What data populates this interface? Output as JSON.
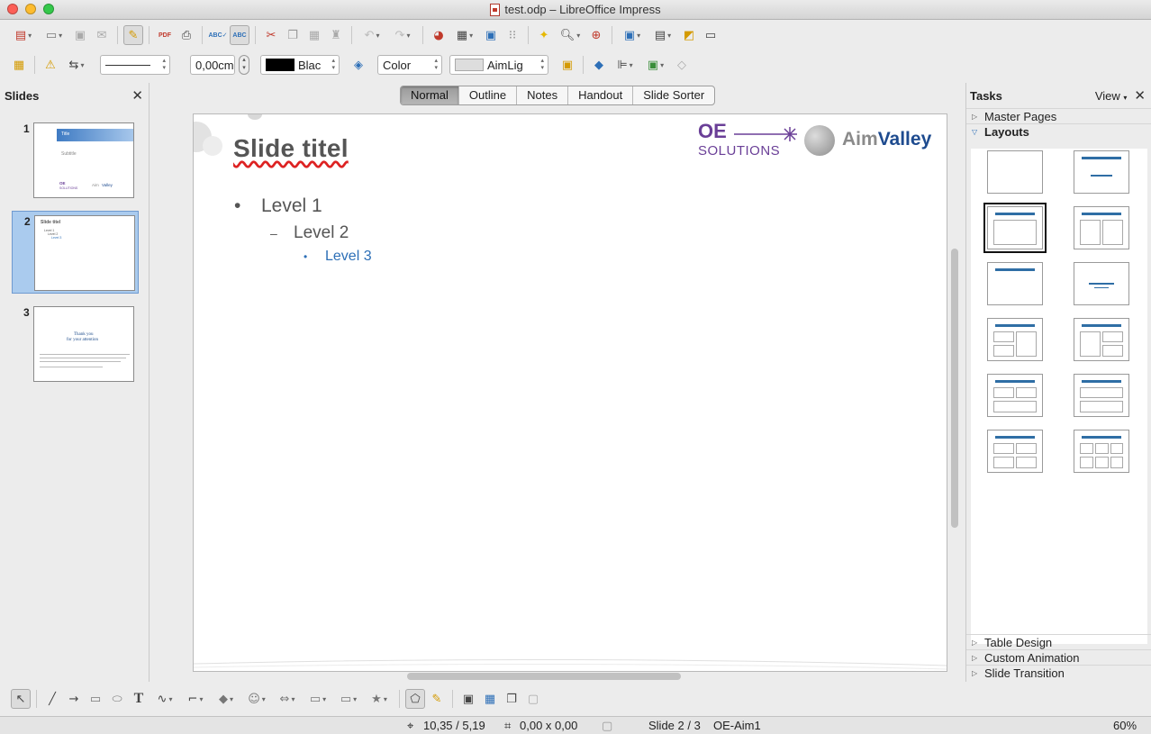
{
  "window": {
    "title": "test.odp – LibreOffice Impress"
  },
  "toolbar2": {
    "line_width": "0,00cm",
    "line_color": "Blac",
    "area_style": "Color",
    "area_fill": "AimLig"
  },
  "slides_panel": {
    "title": "Slides",
    "slides": [
      {
        "number": "1",
        "title": "Title",
        "subtitle": "Subtitle"
      },
      {
        "number": "2",
        "title": "Slide titel"
      },
      {
        "number": "3",
        "title": "Thank you",
        "title2": "for your attention"
      }
    ]
  },
  "view_tabs": [
    "Normal",
    "Outline",
    "Notes",
    "Handout",
    "Slide Sorter"
  ],
  "slide": {
    "title": "Slide titel",
    "bullets": [
      "Level 1",
      "Level 2",
      "Level 3"
    ],
    "bullet_markers": [
      "•",
      "–",
      "•"
    ],
    "logo_oe": "OE",
    "logo_solutions": "SOLUTIONS",
    "logo_aim": "Aim",
    "logo_valley": "Valley"
  },
  "tasks_panel": {
    "title": "Tasks",
    "view_label": "View",
    "sections_top": [
      "Master Pages",
      "Layouts"
    ],
    "sections_bottom": [
      "Table Design",
      "Custom Animation",
      "Slide Transition"
    ]
  },
  "status": {
    "position": "10,35 / 5,19",
    "size": "0,00 x 0,00",
    "slide": "Slide 2 / 3",
    "master": "OE-Aim1",
    "zoom": "60%"
  },
  "colors": {
    "accent": "#2d6fb7",
    "oe_purple": "#6a3f97",
    "aim_blue": "#1e4b8f",
    "selection": "#aacbee"
  }
}
